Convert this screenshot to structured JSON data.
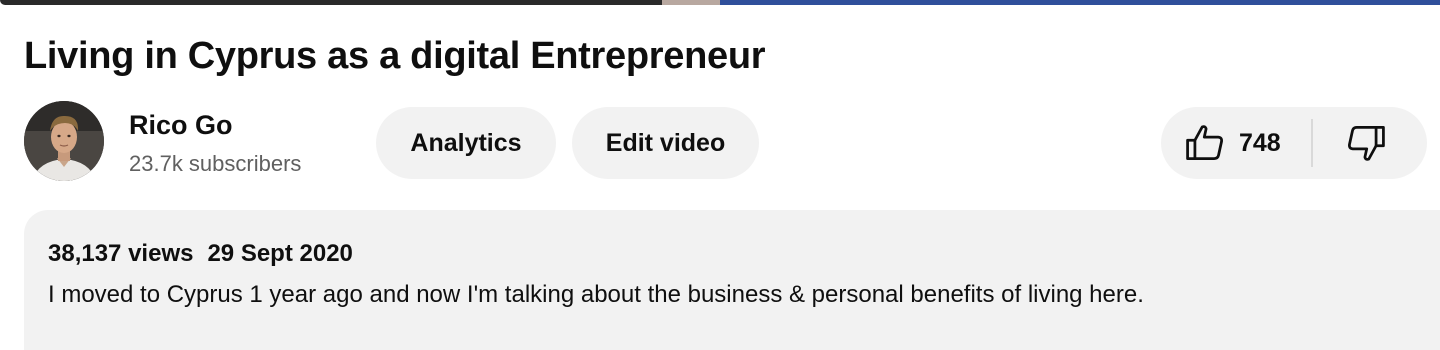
{
  "video": {
    "title": "Living in Cyprus as a digital Entrepreneur"
  },
  "channel": {
    "name": "Rico Go",
    "subscribers": "23.7k subscribers"
  },
  "actions": {
    "analytics_label": "Analytics",
    "edit_label": "Edit video",
    "like_count": "748"
  },
  "description": {
    "views": "38,137 views",
    "date": "29 Sept 2020",
    "text": "I moved to Cyprus 1 year ago and now I'm talking about the business & personal benefits of living here."
  },
  "icons": {
    "like": "thumbs-up-icon",
    "dislike": "thumbs-down-icon"
  },
  "colors": {
    "pill_background": "#f2f2f2",
    "secondary_text": "#606060",
    "primary_text": "#0f0f0f"
  }
}
